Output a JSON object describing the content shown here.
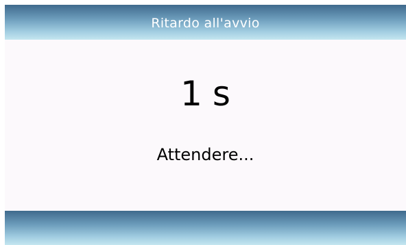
{
  "header": {
    "title": "Ritardo all'avvio"
  },
  "main": {
    "countdown_value": "1",
    "countdown_unit": "s",
    "message": "Attendere..."
  },
  "colors": {
    "bar_gradient_top": "#3f6a8d",
    "bar_gradient_bottom": "#c5e6f0",
    "background": "#fcf9fc",
    "title_text": "#ffffff",
    "body_text": "#000000"
  }
}
